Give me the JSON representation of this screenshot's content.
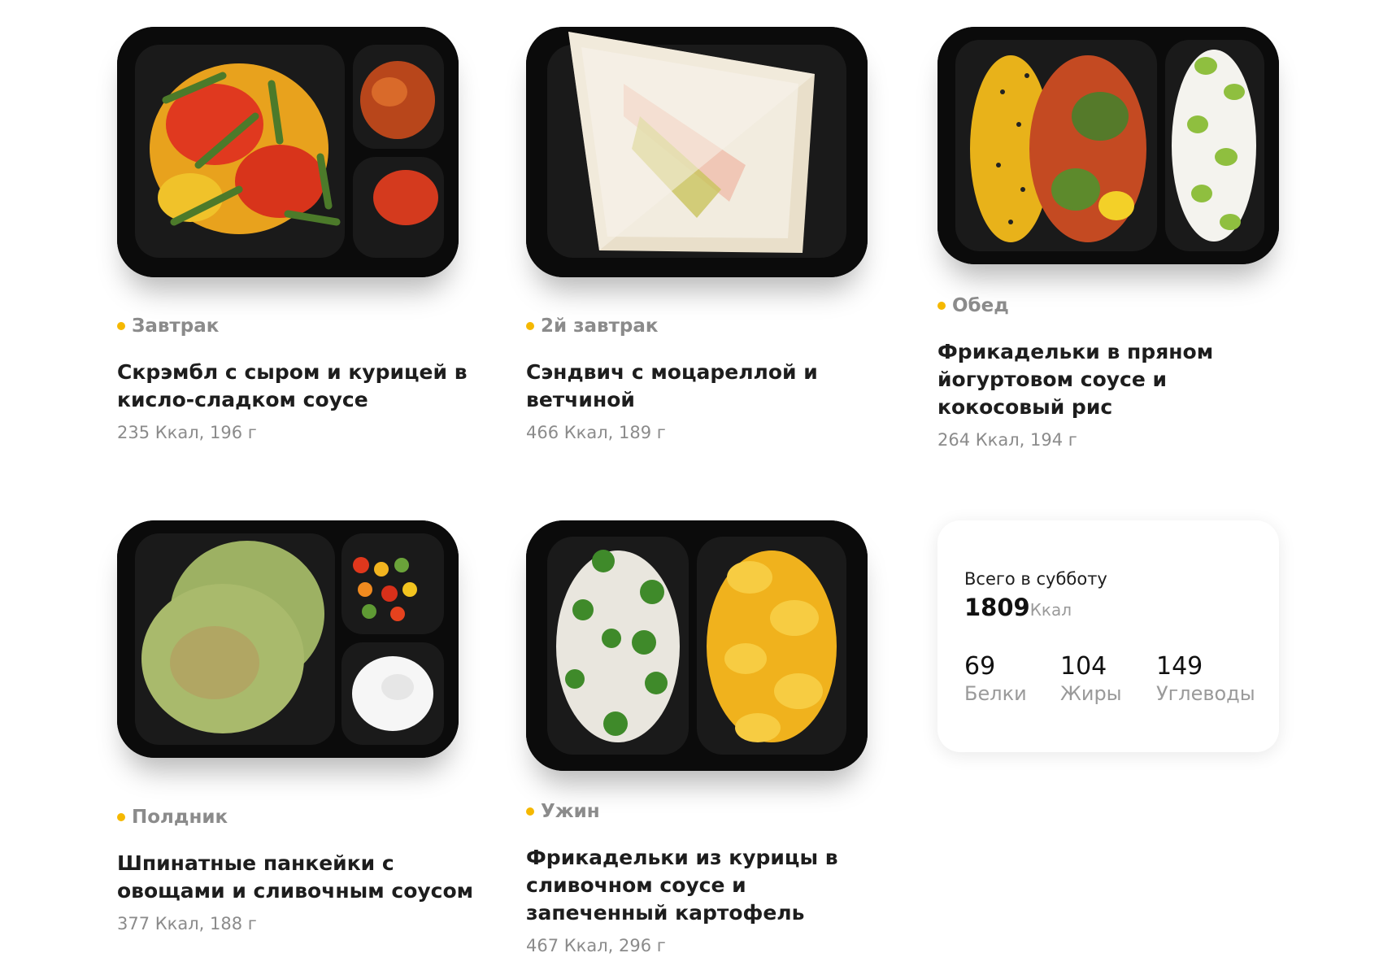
{
  "dishes": [
    {
      "meal": "Завтрак",
      "title": "Скрэмбл с сыром и курицей в кисло-сладком соусе",
      "meta": "235 Ккал, 196 г"
    },
    {
      "meal": "2й завтрак",
      "title": "Сэндвич с моцареллой и ветчиной",
      "meta": "466 Ккал, 189 г"
    },
    {
      "meal": "Обед",
      "title": "Фрикадельки в пряном йогуртовом соусе и кокосовый рис",
      "meta": "264 Ккал, 194 г"
    },
    {
      "meal": "Полдник",
      "title": "Шпинатные панкейки с овощами и сливочным соусом",
      "meta": "377 Ккал, 188 г"
    },
    {
      "meal": "Ужин",
      "title": "Фрикадельки из курицы в сливочном соусе и запеченный картофель",
      "meta": "467 Ккал, 296 г"
    }
  ],
  "summary": {
    "label": "Всего в субботу",
    "total": "1809",
    "unit": "Ккал",
    "macros": [
      {
        "value": "69",
        "label": "Белки"
      },
      {
        "value": "104",
        "label": "Жиры"
      },
      {
        "value": "149",
        "label": "Углеводы"
      }
    ]
  },
  "colors": {
    "accent_dot": "#f5b800",
    "muted_text": "#8b8b8b",
    "title_text": "#1d1d1d"
  }
}
